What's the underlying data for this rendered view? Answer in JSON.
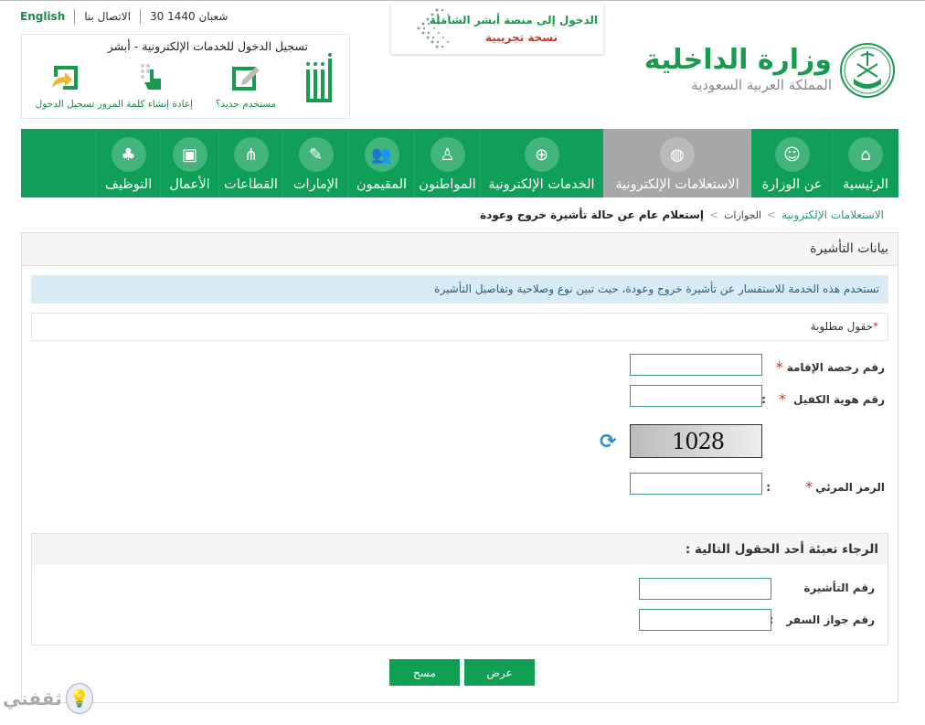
{
  "top_links": {
    "language": "English",
    "contact": "الاتصال بنا",
    "date": "30 شعبان 1440"
  },
  "absher": {
    "title": "تسجيل الدخول للخدمات الإلكترونية - أبشر",
    "items": [
      {
        "label": "مستخدم جديد؟",
        "icon": "edit-icon"
      },
      {
        "label": "إعادة إنشاء كلمة المرور",
        "icon": "touch-keypad-icon"
      },
      {
        "label": "تسجيل الدخول",
        "icon": "login-icon"
      }
    ]
  },
  "promo": {
    "line1": "الدخول إلى منصة أبشر الشاملة",
    "line2": "نسخة تجريبية"
  },
  "ministry": {
    "name": "وزارة الداخلية",
    "country": "المملكة العربية السعودية"
  },
  "nav": {
    "items": [
      {
        "label": "الرئيسية",
        "icon": "home-icon",
        "active": false
      },
      {
        "label": "عن الوزارة",
        "icon": "emblem-icon",
        "active": false
      },
      {
        "label": "الاستعلامات الإلكترونية",
        "icon": "globe-cursor-icon",
        "active": true
      },
      {
        "label": "الخدمات الإلكترونية",
        "icon": "globe-icon",
        "active": false
      },
      {
        "label": "المواطنون",
        "icon": "citizen-icon",
        "active": false
      },
      {
        "label": "المقيمون",
        "icon": "residents-icon",
        "active": false
      },
      {
        "label": "الإمارات",
        "icon": "emirates-icon",
        "active": false
      },
      {
        "label": "القطاعات",
        "icon": "sectors-icon",
        "active": false
      },
      {
        "label": "الأعمال",
        "icon": "briefcase-icon",
        "active": false
      },
      {
        "label": "التوظيف",
        "icon": "employment-icon",
        "active": false
      }
    ]
  },
  "breadcrumb": {
    "level1": "الاستعلامات الإلكترونية",
    "level2": "الجوازات",
    "current": "إستعلام عام عن حالة تأشيرة خروج وعودة",
    "separator": ">"
  },
  "panel": {
    "title": "بيانات التأشيرة",
    "info": "تستخدم هذه الخدمة للاستفسار عن تأشيرة خروج وعودة، حيث تبين نوع وصلاحية وتفاصيل التأشيرة",
    "required_note": "حقول مطلوبة",
    "required_star": "*",
    "fields": {
      "iqama": {
        "label": "رقم رخصة الإقامة",
        "value": ""
      },
      "sponsor_id": {
        "label": "رقم هوية الكفيل",
        "value": ""
      },
      "captcha_code": {
        "label": "الرمز المرئي",
        "value": ""
      }
    },
    "captcha_image_text": "1028",
    "colon": ":"
  },
  "optional": {
    "title": "الرجاء تعبئة أحد الحقول التالية :",
    "fields": {
      "visa_number": {
        "label": "رقم التأشيرة",
        "value": ""
      },
      "passport_number": {
        "label": "رقم جواز السفر",
        "value": ""
      }
    }
  },
  "buttons": {
    "show": "عرض",
    "clear": "مسح"
  },
  "watermark": {
    "text": "ثقفني"
  },
  "colors": {
    "brand_green": "#0f9f58",
    "active_nav": "#a7a7a7",
    "info_bg": "#d9ecf5",
    "required_star": "#c0392b"
  }
}
